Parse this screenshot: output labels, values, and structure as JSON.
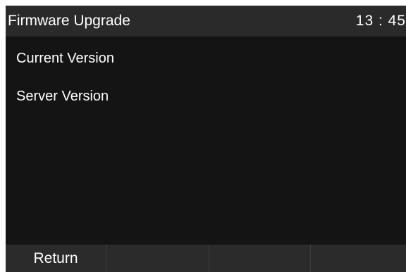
{
  "header": {
    "title": "Firmware Upgrade",
    "time": "13 : 45"
  },
  "main": {
    "items": [
      {
        "label": "Current Version"
      },
      {
        "label": "Server Version"
      }
    ]
  },
  "softkeys": [
    {
      "label": "Return"
    },
    {
      "label": ""
    },
    {
      "label": ""
    },
    {
      "label": ""
    }
  ],
  "colors": {
    "screen_background": "#121212",
    "title_bar": "#2a2a2a",
    "softkey_bar": "#2b2b2b",
    "text": "#ffffff"
  }
}
